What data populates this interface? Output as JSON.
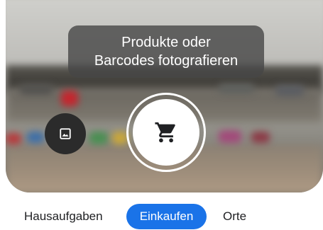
{
  "hint": {
    "line1": "Produkte oder",
    "line2": "Barcodes fotografieren"
  },
  "controls": {
    "gallery_icon": "image-icon",
    "shutter_icon": "shopping-cart-icon"
  },
  "modes": {
    "items": [
      {
        "label": "Hausaufgaben",
        "active": false
      },
      {
        "label": "Einkaufen",
        "active": true
      },
      {
        "label": "Orte",
        "active": false
      }
    ]
  },
  "colors": {
    "active_mode": "#1a73e8",
    "hint_bubble": "#464646",
    "background": "#ffffff"
  }
}
